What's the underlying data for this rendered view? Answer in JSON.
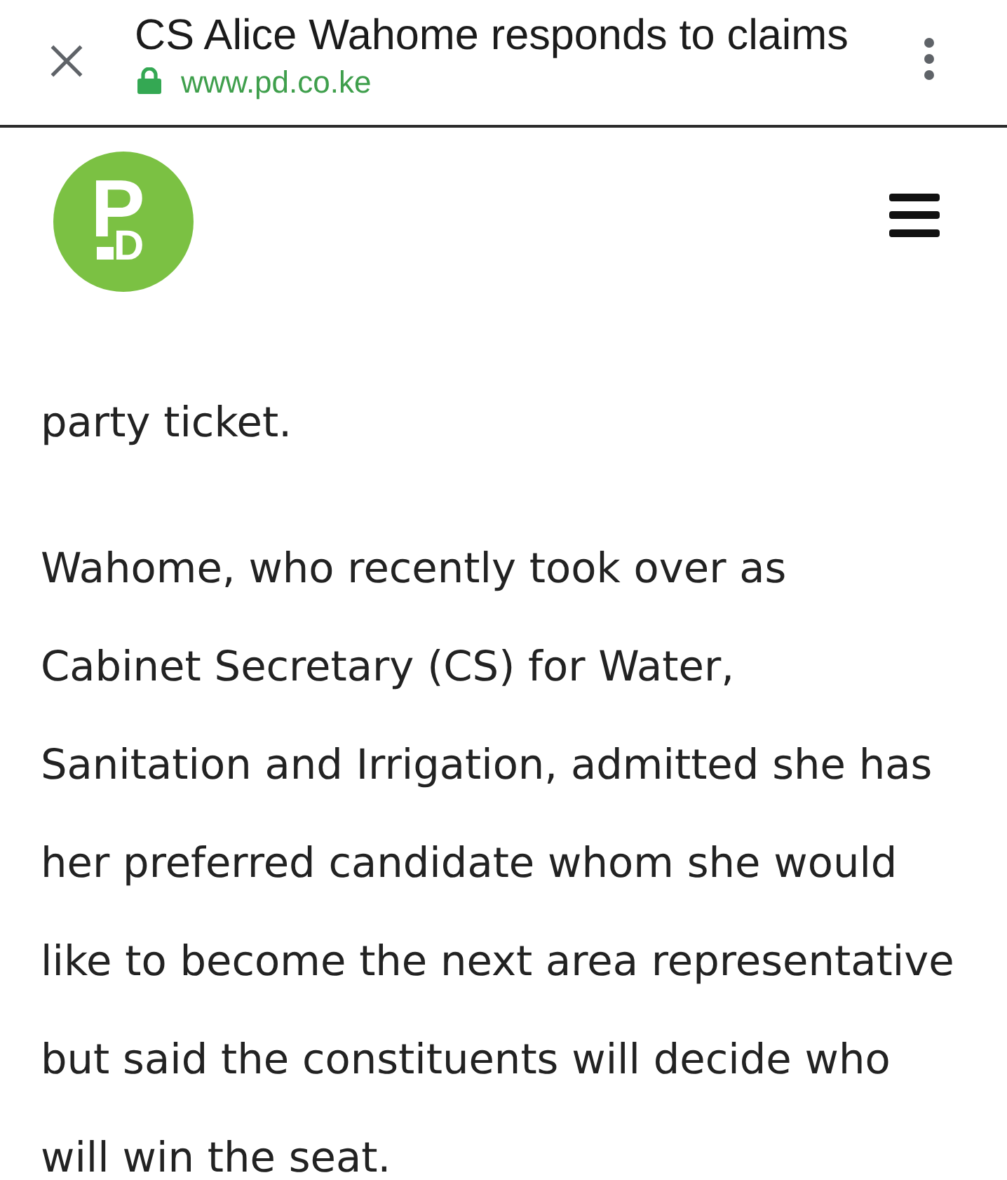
{
  "browser_bar": {
    "title": "CS Alice Wahome responds to claims",
    "url": "www.pd.co.ke",
    "secure": true
  },
  "site_header": {
    "logo_letters": [
      "P",
      "D"
    ]
  },
  "article": {
    "paragraphs": [
      {
        "lines": [
          "party ticket."
        ]
      },
      {
        "lines": [
          "Wahome, who recently took over as",
          "Cabinet Secretary (CS) for Water,",
          "Sanitation and Irrigation, admitted she has",
          "her preferred candidate whom she would",
          "like to become the next area representative",
          "but said the constituents will decide who",
          "will win the seat."
        ]
      }
    ]
  }
}
